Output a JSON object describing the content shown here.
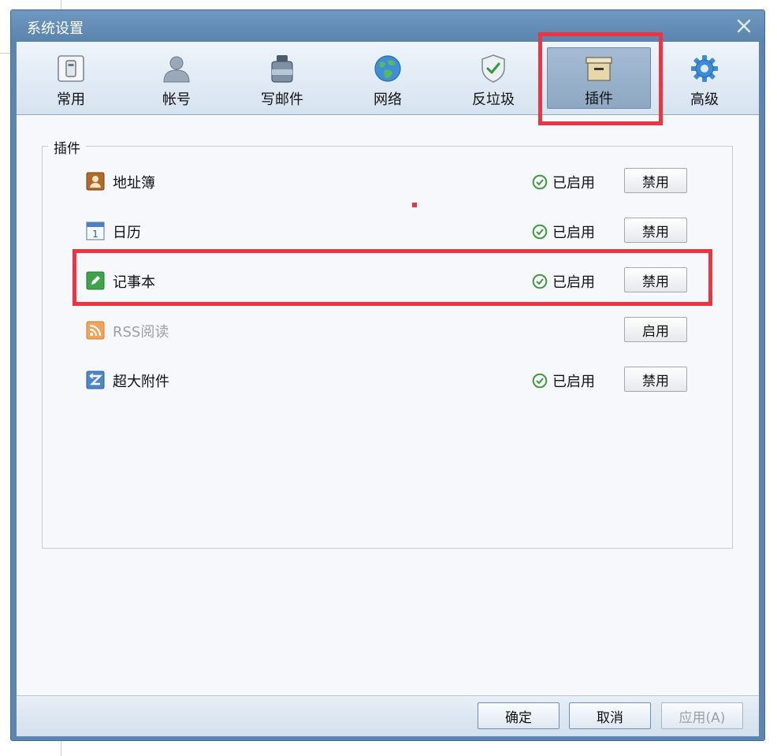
{
  "window": {
    "title": "系统设置",
    "close_icon": "close-icon"
  },
  "tabs": [
    {
      "label": "常用",
      "icon": "switch-icon"
    },
    {
      "label": "帐号",
      "icon": "user-icon"
    },
    {
      "label": "写邮件",
      "icon": "ink-bottle-icon"
    },
    {
      "label": "网络",
      "icon": "globe-icon"
    },
    {
      "label": "反垃圾",
      "icon": "shield-icon"
    },
    {
      "label": "插件",
      "icon": "archive-box-icon",
      "selected": true
    },
    {
      "label": "高级",
      "icon": "gear-icon"
    }
  ],
  "plugins": {
    "legend": "插件",
    "items": [
      {
        "name": "地址簿",
        "icon": "address-book-icon",
        "status": "已启用",
        "button": "禁用",
        "enabled": true
      },
      {
        "name": "日历",
        "icon": "calendar-icon",
        "status": "已启用",
        "button": "禁用",
        "enabled": true
      },
      {
        "name": "记事本",
        "icon": "notepad-icon",
        "status": "已启用",
        "button": "禁用",
        "enabled": true
      },
      {
        "name": "RSS阅读",
        "icon": "rss-icon",
        "status": "",
        "button": "启用",
        "enabled": false
      },
      {
        "name": "超大附件",
        "icon": "large-attachment-icon",
        "status": "已启用",
        "button": "禁用",
        "enabled": true
      }
    ]
  },
  "footer": {
    "ok": "确定",
    "cancel": "取消",
    "apply": "应用(A)"
  },
  "colors": {
    "highlight_red": "#ef3340",
    "titlebar_blue": "#5c86b0",
    "check_green": "#3f9b3f"
  }
}
